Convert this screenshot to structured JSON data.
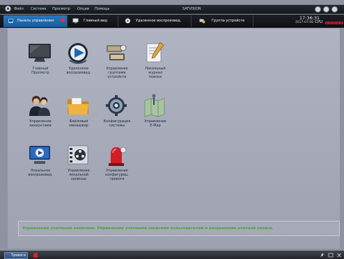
{
  "menu": {
    "items": [
      "Файл",
      "Система",
      "Просмотр",
      "Опции",
      "Помощь"
    ]
  },
  "window": {
    "title": "SATVISION"
  },
  "tabs": [
    {
      "label": "Панель управления",
      "active": true
    },
    {
      "label": "Главный вид",
      "active": false
    },
    {
      "label": "Удаленное воспроизвед.",
      "active": false
    },
    {
      "label": "Группа устройств",
      "active": false
    }
  ],
  "status": {
    "time": "17:36:31",
    "date": "2017-07-06",
    "cpu_label": "CPU"
  },
  "tiles": [
    {
      "label": "Главный\nПросмотр",
      "icon": "monitor-icon"
    },
    {
      "label": "Удаленное\nвоспроизвед.",
      "icon": "remote-playback-icon"
    },
    {
      "label": "Управление\nгруппами\nустройств",
      "icon": "device-group-icon"
    },
    {
      "label": "Локальный\nжурнал\nпоиска",
      "icon": "log-search-icon"
    },
    {
      "label": "Управление\nаккаунтами",
      "icon": "accounts-icon"
    },
    {
      "label": "Файловый\nменеджер",
      "icon": "folder-icon"
    },
    {
      "label": "Конфигурация\nсистемы",
      "icon": "system-config-icon"
    },
    {
      "label": "Управление\nE-Map",
      "icon": "emap-icon"
    },
    {
      "label": "Локальное\nвоспроизвед.",
      "icon": "local-playback-icon"
    },
    {
      "label": "Управление\nлокальной\nзаписью",
      "icon": "local-record-icon"
    },
    {
      "label": "Управление\nконфигурац.\nтревоги",
      "icon": "alarm-config-icon"
    }
  ],
  "description": "Управление учетными записями: Управление учетными записями пользователей и разрешение учетной записи.",
  "bottom": {
    "alarm_tab": "Тревога"
  },
  "colors": {
    "accent": "#2a79bf",
    "description_text": "#48a530",
    "cpu_meter": "#e3243a"
  }
}
